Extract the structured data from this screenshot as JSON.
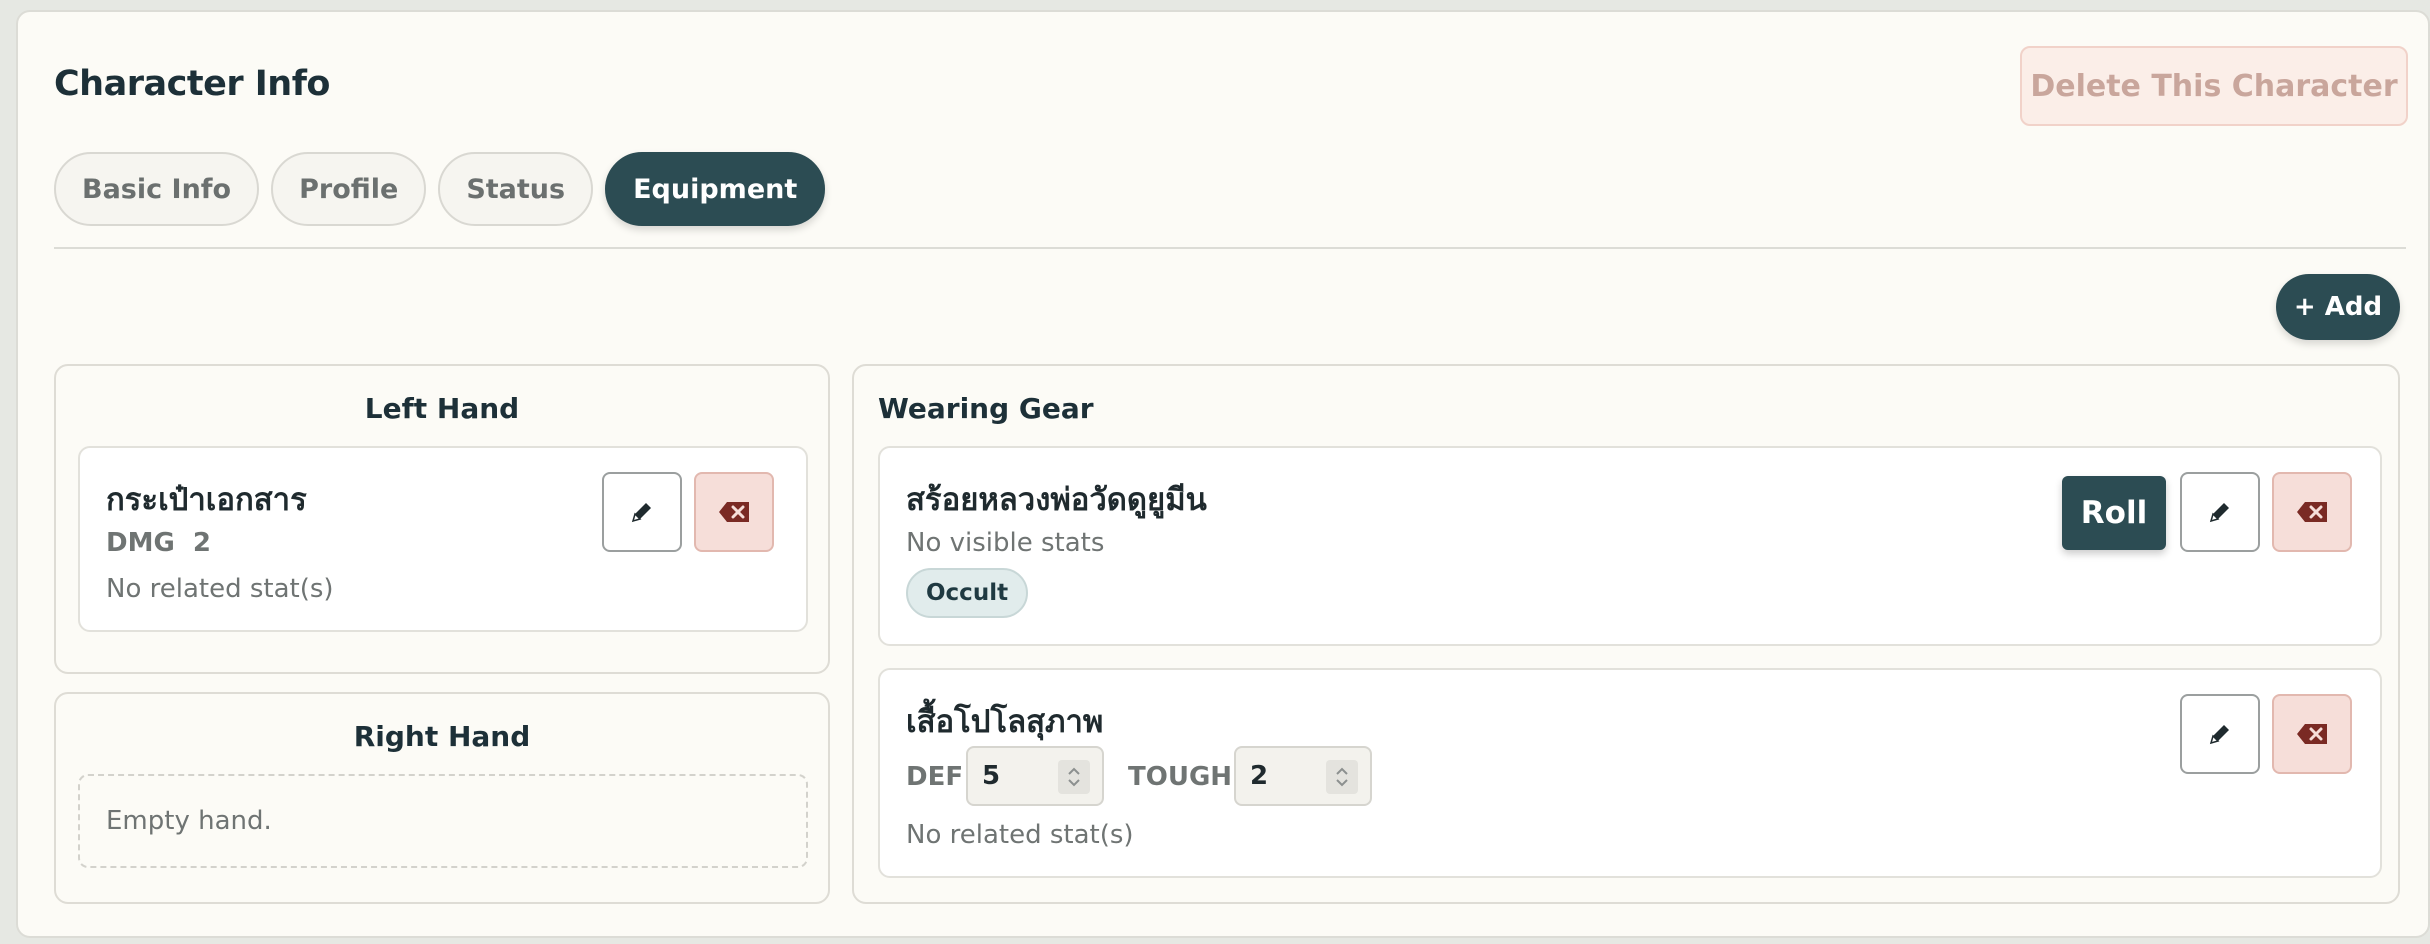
{
  "header": {
    "title": "Character Info",
    "delete_label": "Delete This Character"
  },
  "tabs": [
    {
      "label": "Basic Info",
      "active": false
    },
    {
      "label": "Profile",
      "active": false
    },
    {
      "label": "Status",
      "active": false
    },
    {
      "label": "Equipment",
      "active": true
    }
  ],
  "add_label": "+ Add",
  "left_hand": {
    "title": "Left Hand",
    "item": {
      "name": "กระเป๋าเอกสาร",
      "dmg_label": "DMG",
      "dmg_value": "2",
      "related": "No related stat(s)"
    }
  },
  "right_hand": {
    "title": "Right Hand",
    "empty_text": "Empty hand."
  },
  "wearing": {
    "title": "Wearing Gear",
    "items": [
      {
        "name": "สร้อยหลวงพ่อวัดดูยูมีน",
        "stats": "No visible stats",
        "tag": "Occult",
        "roll_label": "Roll"
      },
      {
        "name": "เสื้อโปโลสุภาพ",
        "def_label": "DEF",
        "def_value": "5",
        "tough_label": "TOUGH",
        "tough_value": "2",
        "related": "No related stat(s)"
      }
    ]
  },
  "icons": {
    "edit": "pencil-icon",
    "delete": "backspace-icon",
    "stepper": "chevron-updown-icon"
  },
  "colors": {
    "accent": "#2c4c53",
    "danger_bg": "#f6ded9",
    "danger_icon": "#7a2a24",
    "panel_bg": "#fcfbf6"
  }
}
